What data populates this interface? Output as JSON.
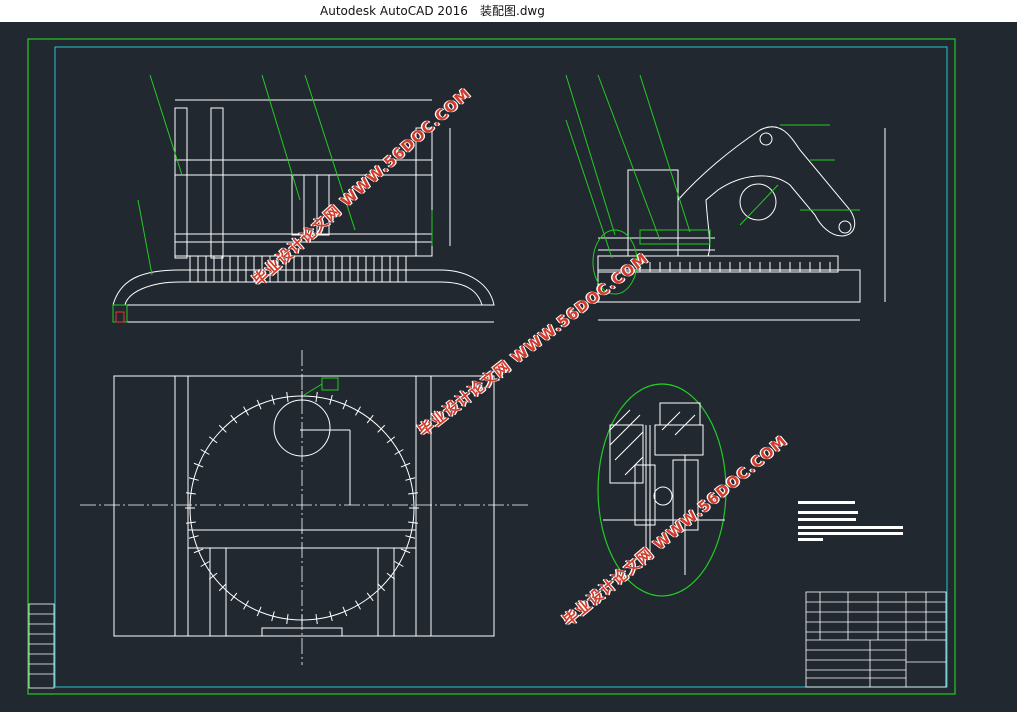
{
  "window": {
    "app_title": "Autodesk AutoCAD 2016",
    "document_title": "装配图.dwg"
  },
  "colors": {
    "background": "#212830",
    "frame_green": "#22cc22",
    "frame_cyan": "#22c9cf",
    "lines_white": "#ffffff",
    "watermark_red": "#d23c2c",
    "titlebar": "#ffffff"
  },
  "watermarks": [
    {
      "site": "WWW.56DOC.COM",
      "label": "毕业设计论文网"
    },
    {
      "site": "WWW.56DOC.COM",
      "label": "毕业设计论文网"
    },
    {
      "site": "WWW.56DOC.COM",
      "label": "毕业设计论文网"
    }
  ],
  "views": [
    "front-view",
    "side-view",
    "top-view",
    "detail-view",
    "notes",
    "title-block",
    "revision-table"
  ]
}
